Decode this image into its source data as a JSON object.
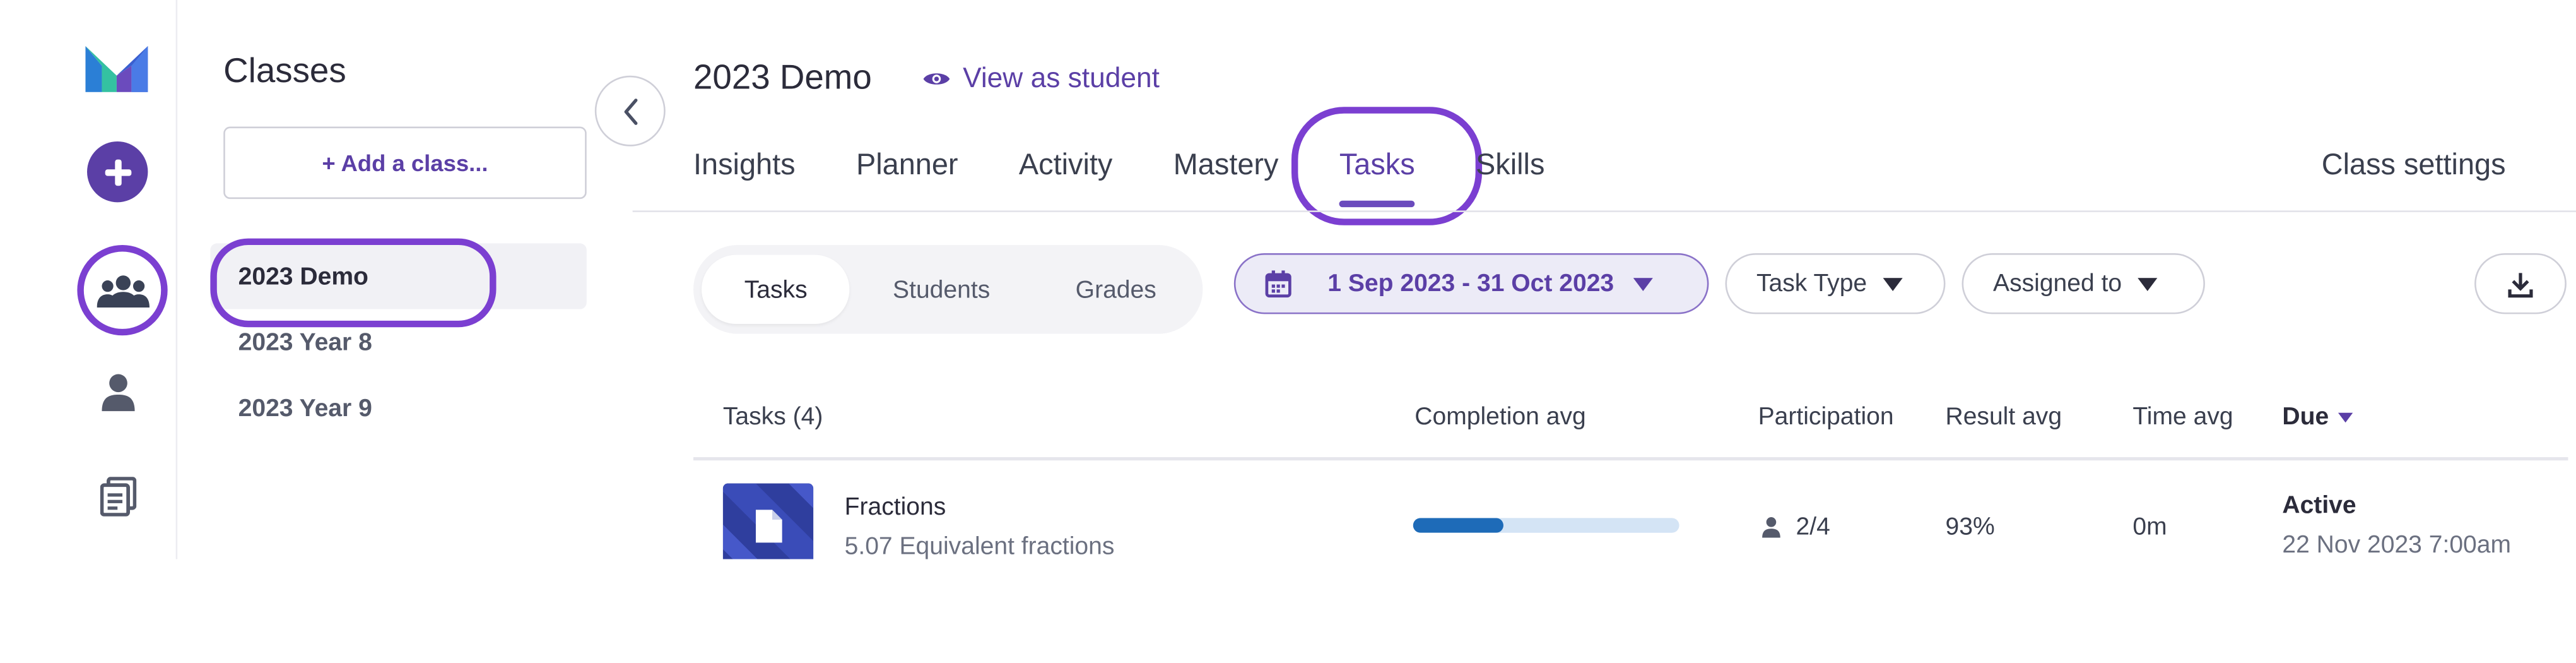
{
  "rail": {
    "accent": "#5b3fa6",
    "icons": [
      "mathspace-logo-icon",
      "add-icon",
      "classes-group-icon",
      "person-icon",
      "documents-icon"
    ]
  },
  "classes": {
    "title": "Classes",
    "add_label": "+ Add a class...",
    "items": [
      "2023 Demo",
      "2023 Year 8",
      "2023 Year 9"
    ],
    "active": "2023 Demo"
  },
  "main": {
    "title": "2023 Demo",
    "view_as_student": "View as student",
    "tabs": [
      {
        "label": "Insights"
      },
      {
        "label": "Planner"
      },
      {
        "label": "Activity"
      },
      {
        "label": "Mastery"
      },
      {
        "label": "Tasks",
        "active": true
      },
      {
        "label": "Skills"
      }
    ],
    "class_settings": "Class settings"
  },
  "filters": {
    "segments": [
      "Tasks",
      "Students",
      "Grades"
    ],
    "active_segment": "Tasks",
    "date_range": "1 Sep 2023 - 31 Oct 2023",
    "task_type": "Task Type",
    "assigned_to": "Assigned to"
  },
  "table": {
    "headers": [
      "Tasks (4)",
      "Completion avg",
      "Participation",
      "Result avg",
      "Time avg",
      "Due"
    ],
    "rows": [
      {
        "name": "Fractions",
        "subtitle": "5.07 Equivalent fractions",
        "completion": 0.34,
        "participation": "2/4",
        "result_avg": "93%",
        "time_avg": "0m",
        "due_status": "Active",
        "due_date": "22 Nov 2023 7:00am"
      }
    ]
  }
}
